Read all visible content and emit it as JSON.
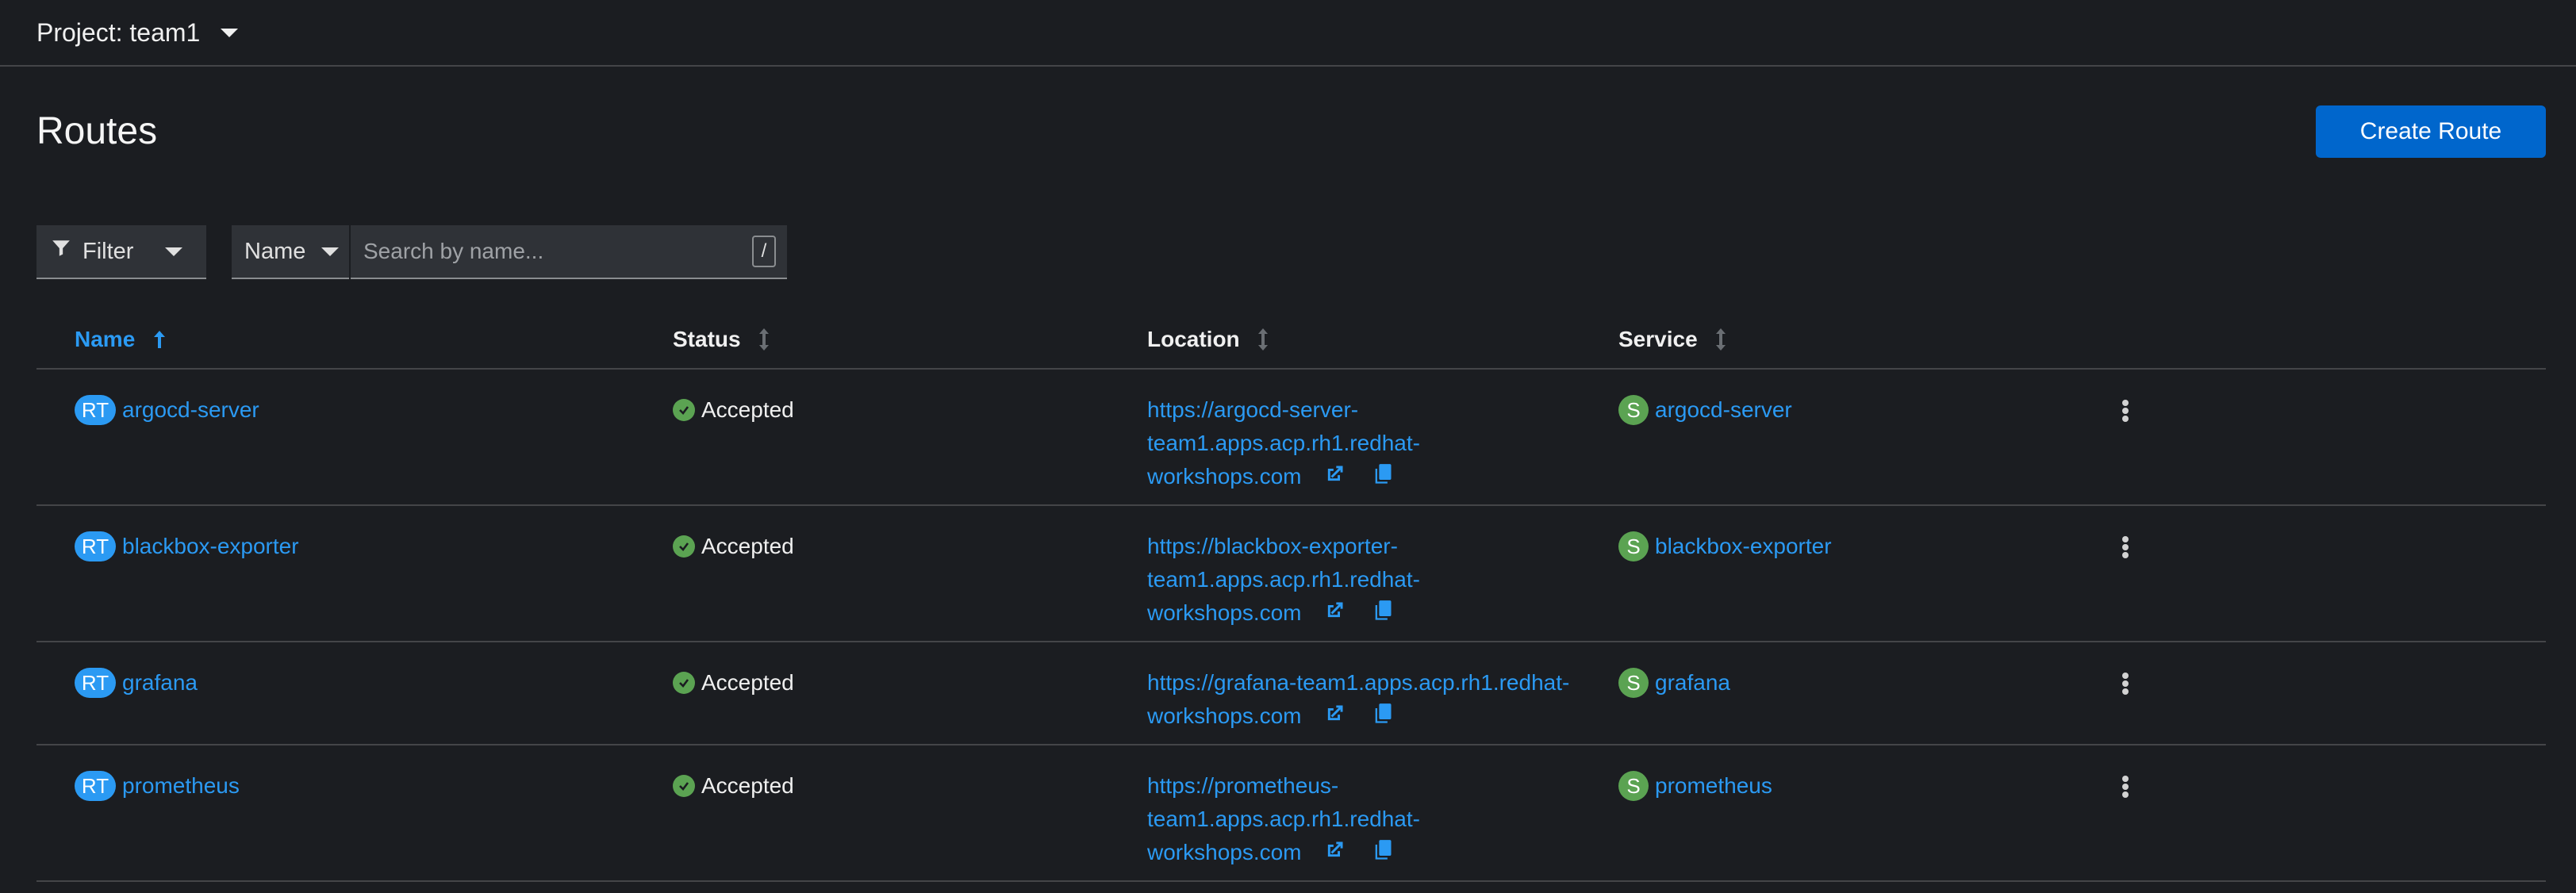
{
  "project": {
    "label": "Project: team1"
  },
  "page": {
    "title": "Routes",
    "create_button": "Create Route"
  },
  "toolbar": {
    "filter_label": "Filter",
    "attribute_label": "Name",
    "search_placeholder": "Search by name...",
    "shortcut_key": "/"
  },
  "table": {
    "columns": [
      "Name",
      "Status",
      "Location",
      "Service"
    ],
    "sorted_column": "Name",
    "sort_direction": "ascending",
    "rows": [
      {
        "badge": "RT",
        "name": "argocd-server",
        "status": "Accepted",
        "location_lines": [
          "https://argocd-server-",
          "team1.apps.acp.rh1.redhat-",
          "workshops.com"
        ],
        "service_badge": "S",
        "service": "argocd-server"
      },
      {
        "badge": "RT",
        "name": "blackbox-exporter",
        "status": "Accepted",
        "location_lines": [
          "https://blackbox-exporter-",
          "team1.apps.acp.rh1.redhat-",
          "workshops.com"
        ],
        "service_badge": "S",
        "service": "blackbox-exporter"
      },
      {
        "badge": "RT",
        "name": "grafana",
        "status": "Accepted",
        "location_lines": [
          "https://grafana-team1.apps.acp.rh1.redhat-",
          "workshops.com"
        ],
        "service_badge": "S",
        "service": "grafana"
      },
      {
        "badge": "RT",
        "name": "prometheus",
        "status": "Accepted",
        "location_lines": [
          "https://prometheus-",
          "team1.apps.acp.rh1.redhat-",
          "workshops.com"
        ],
        "service_badge": "S",
        "service": "prometheus"
      }
    ]
  },
  "colors": {
    "background": "#1b1d21",
    "link": "#2b9af3",
    "primary_button": "#0066cc",
    "success": "#5ba352",
    "service_badge": "#5ba352",
    "route_badge": "#2b9af3"
  },
  "icons": {
    "project_caret": "caret-down-icon",
    "filter": "filter-icon",
    "sort_active": "sort-ascending-icon",
    "sort_inactive": "sort-icon",
    "status": "check-circle-icon",
    "external_link": "external-link-icon",
    "copy": "copy-icon",
    "row_actions": "kebab-icon"
  }
}
